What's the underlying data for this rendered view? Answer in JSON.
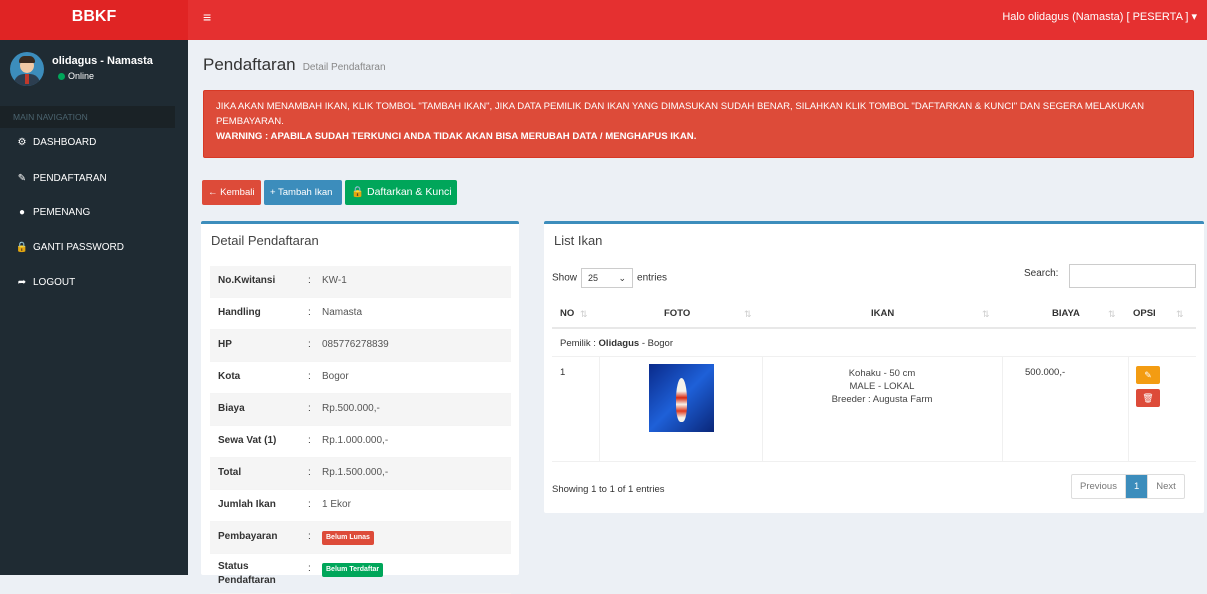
{
  "app": {
    "logo": "BBKF"
  },
  "header": {
    "toggle_icon": "≡",
    "user_menu": "Halo olidagus (Namasta) [ PESERTA ] ▾"
  },
  "sidebar": {
    "user_name": "olidagus - Namasta",
    "user_status": "Online",
    "nav_header": "MAIN NAVIGATION",
    "items": [
      {
        "label": "DASHBOARD",
        "icon": "dashboard-icon",
        "glyph": "⚙"
      },
      {
        "label": "PENDAFTARAN",
        "icon": "edit-icon",
        "glyph": "✎"
      },
      {
        "label": "PEMENANG",
        "icon": "circle-icon",
        "glyph": "●"
      },
      {
        "label": "GANTI PASSWORD",
        "icon": "lock-icon",
        "glyph": "🔒"
      },
      {
        "label": "LOGOUT",
        "icon": "share-icon",
        "glyph": "➦"
      }
    ]
  },
  "page": {
    "title": "Pendaftaran",
    "subtitle": "Detail Pendaftaran"
  },
  "alert": {
    "line1": "JIKA AKAN MENAMBAH IKAN, KLIK TOMBOL \"TAMBAH IKAN\", JIKA DATA PEMILIK DAN IKAN YANG DIMASUKAN SUDAH BENAR, SILAHKAN KLIK TOMBOL \"DAFTARKAN & KUNCI\" DAN SEGERA MELAKUKAN PEMBAYARAN.",
    "warning": "WARNING : APABILA SUDAH TERKUNCI ANDA TIDAK AKAN BISA MERUBAH DATA / MENGHAPUS IKAN."
  },
  "actions": {
    "back": "← Kembali",
    "add": "+ Tambah Ikan",
    "register": "🔒 Daftarkan & Kunci"
  },
  "detail": {
    "title": "Detail Pendaftaran",
    "rows": [
      {
        "label": "No.Kwitansi",
        "value": "KW-1"
      },
      {
        "label": "Handling",
        "value": "Namasta"
      },
      {
        "label": "HP",
        "value": "085776278839"
      },
      {
        "label": "Kota",
        "value": "Bogor"
      },
      {
        "label": "Biaya",
        "value": "Rp.500.000,-"
      },
      {
        "label": "Sewa Vat (1)",
        "value": "Rp.1.000.000,-"
      },
      {
        "label": "Total",
        "value": "Rp.1.500.000,-"
      },
      {
        "label": "Jumlah Ikan",
        "value": "1 Ekor"
      }
    ],
    "pembayaran_label": "Pembayaran",
    "pembayaran_badge": "Belum Lunas",
    "status_label": "Status Pendaftaran",
    "status_badge": "Belum Terdaftar",
    "colon": ":"
  },
  "list": {
    "title": "List Ikan",
    "show_prefix": "Show",
    "page_size": "25",
    "show_suffix": "entries",
    "search_label": "Search:",
    "columns": [
      "NO",
      "FOTO",
      "IKAN",
      "BIAYA",
      "OPSI"
    ],
    "owner_prefix": "Pemilik :",
    "owner_name": "Olidagus",
    "owner_city": "- Bogor",
    "rows": [
      {
        "no": "1",
        "ikan_line1": "Kohaku - 50 cm",
        "ikan_line2": "MALE - LOKAL",
        "ikan_line3": "Breeder : Augusta Farm",
        "biaya": "500.000,-"
      }
    ],
    "info": "Showing 1 to 1 of 1 entries",
    "pager": {
      "previous": "Previous",
      "current": "1",
      "next": "Next"
    }
  }
}
